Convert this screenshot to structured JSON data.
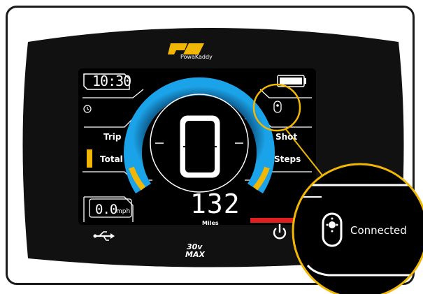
{
  "brand": {
    "logo_text": "PK",
    "name": "PowaKaddy"
  },
  "model": {
    "line1": "30v",
    "line2": "MAX"
  },
  "display": {
    "time": "10:30",
    "labels": {
      "trip": "Trip",
      "total": "Total",
      "shot": "Shot",
      "steps": "Steps"
    },
    "speed": {
      "value": "0.0",
      "unit": "mph"
    },
    "distance": {
      "value": "132",
      "unit": "Miles"
    },
    "speed_level": "0",
    "battery_level_fraction": 1.0
  },
  "callout": {
    "status": "Connected",
    "icon": "remote-control-icon"
  },
  "buttons": {
    "usb_icon": "usb-icon",
    "power_icon": "power-icon"
  },
  "colors": {
    "arc_blue": "#1aa3e8",
    "accent_yellow": "#f2b705",
    "accent_red": "#e0201f",
    "callout_ring": "#f2b705",
    "screen_bg": "#000000",
    "bezel": "#111111"
  }
}
